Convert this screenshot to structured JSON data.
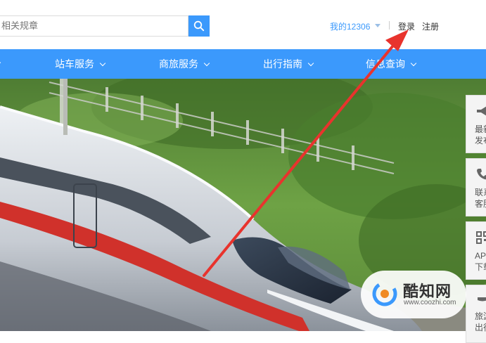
{
  "header": {
    "search": {
      "placeholder": "相关规章"
    },
    "account_menu": "我的12306",
    "login": "登录",
    "register": "注册"
  },
  "nav": {
    "items": [
      {
        "label": "站车服务"
      },
      {
        "label": "商旅服务"
      },
      {
        "label": "出行指南"
      },
      {
        "label": "信息查询"
      }
    ]
  },
  "side_panel": [
    {
      "icon": "megaphone-icon",
      "lines": [
        "最新",
        "发布"
      ]
    },
    {
      "icon": "phone-icon",
      "lines": [
        "联系",
        "客服"
      ]
    },
    {
      "icon": "qrcode-icon",
      "lines": [
        "APP",
        "下载"
      ]
    },
    {
      "icon": "suitcase-icon",
      "lines": [
        "旅游",
        "出行"
      ]
    }
  ],
  "watermark": {
    "name": "酷知网",
    "url": "www.coozhi.com"
  },
  "colors": {
    "brand_blue": "#3b99fc",
    "annotation_red": "#e8332d"
  }
}
